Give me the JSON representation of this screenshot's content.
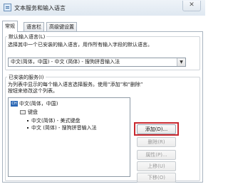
{
  "window": {
    "title": "文本服务和输入语言",
    "close_label": "✕"
  },
  "tabs": [
    {
      "label": "常规"
    },
    {
      "label": "语言栏"
    },
    {
      "label": "高级键设置"
    }
  ],
  "default_input": {
    "group_label": "默认输入语言(L)",
    "description": "选择其中一个已安装的输入语言，用作所有输入字段的默认语言。",
    "selected_value": "中文(简体，中国) - 中文 (简体) - 搜狗拼音输入法"
  },
  "installed_services": {
    "group_label": "已安装的服务(I)",
    "description_line1": "为列表中显示的每个输入语言选择服务。使用“添加”和“删除”",
    "description_line2": "按钮来修改这个列表。",
    "tree": {
      "language_icon_text": "CH",
      "language": "中文(简体，中国)",
      "category": "键盘",
      "services": [
        "中文(简体) - 美式键盘",
        "中文 (简体) - 搜狗拼音输入法"
      ]
    }
  },
  "buttons": {
    "add": "添加(D)...",
    "remove": "删除(R)",
    "properties": "属性(P)...",
    "move_up": "上移(U)",
    "move_down": "下移(O)"
  },
  "colors": {
    "highlight_border": "#c8282f",
    "language_icon": "#2d69b5"
  }
}
